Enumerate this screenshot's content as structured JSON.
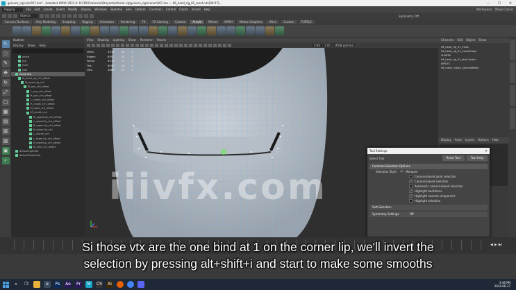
{
  "window": {
    "title": "guiasco_rig(vis)r007.ma* - Autodesk MAYA 2022.4: D:\\3D\\Comercial\\Proyectos\\facial rig\\guiasco_rig\\scenes\\007.ma --- 06_head_rig_01_mesh.vtx[99:07]...",
    "minimize": "—",
    "maximize": "☐",
    "close": "✕"
  },
  "menubar": {
    "mode": "Rigging",
    "items": [
      "File",
      "Edit",
      "Create",
      "Select",
      "Modify",
      "Display",
      "Windows",
      "Skeleton",
      "Skin",
      "Deform",
      "Constrain",
      "Control",
      "Cache",
      "Arnold",
      "Help"
    ],
    "workspace_label": "Workspace:",
    "workspace_value": "Maya Classic"
  },
  "statusline": {
    "field1": "Objects",
    "symmetry": "Symmetry: Off"
  },
  "shelf_tabs": [
    "Curves / Surfaces",
    "Poly Modeling",
    "Sculpting",
    "Rigging",
    "Animation",
    "Rendering",
    "FX",
    "FX Caching",
    "Custom",
    "Arnold",
    "Bifrost",
    "MASH",
    "Motion Graphics",
    "XGen",
    "Custom",
    "TURTLE"
  ],
  "shelf_active_index": 9,
  "outliner": {
    "title": "Outliner",
    "menu": [
      "Display",
      "Show",
      "Help"
    ],
    "rows": [
      {
        "label": "persp",
        "indent": 2
      },
      {
        "label": "top",
        "indent": 2
      },
      {
        "label": "front",
        "indent": 2
      },
      {
        "label": "side",
        "indent": 2
      },
      {
        "label": "head_Grp",
        "indent": 1
      },
      {
        "label": "M_head_rig_ctrl_offset",
        "indent": 2
      },
      {
        "label": "M_head_rig_ctrl",
        "indent": 3
      },
      {
        "label": "M_jaw_ctrl_offset",
        "indent": 4
      },
      {
        "label": "L_eye_ctrl_offset",
        "indent": 5
      },
      {
        "label": "R_eye_ctrl_offset",
        "indent": 5
      },
      {
        "label": "L_cheek_ctrl_offset",
        "indent": 5
      },
      {
        "label": "R_cheek_ctrl_offset",
        "indent": 5
      },
      {
        "label": "M_nose_ctrl_offset",
        "indent": 5
      },
      {
        "label": "M_mouth_ctrl",
        "indent": 5
      },
      {
        "label": "M_upperLip_ctrl_offset",
        "indent": 6
      },
      {
        "label": "L_upperLip_ctrl_offset",
        "indent": 6
      },
      {
        "label": "R_upperLip_ctrl_offset",
        "indent": 6
      },
      {
        "label": "M_lowerLip_ctrl",
        "indent": 6
      },
      {
        "label": "L_corner_ctrl",
        "indent": 6
      },
      {
        "label": "L_lowerLip_ctrl_offset",
        "indent": 6
      },
      {
        "label": "R_lowerLip_ctrl_offset",
        "indent": 6
      },
      {
        "label": "M_chin_ctrl_offset",
        "indent": 6
      },
      {
        "label": "defaultLightSet",
        "indent": 1
      },
      {
        "label": "defaultObjectSet",
        "indent": 1
      }
    ],
    "highlighted_index": 4
  },
  "viewport": {
    "menu": [
      "View",
      "Shading",
      "Lighting",
      "Show",
      "Renderer",
      "Panels"
    ],
    "hud": [
      {
        "label": "Verts:",
        "a": "4316",
        "b": "40",
        "c": "0"
      },
      {
        "label": "Edges:",
        "a": "8592",
        "b": "52",
        "c": "0"
      },
      {
        "label": "Faces:",
        "a": "4278",
        "b": "13",
        "c": "0"
      },
      {
        "label": "Tris:",
        "a": "8496",
        "b": "26",
        "c": "0"
      },
      {
        "label": "UVs:",
        "a": "4686",
        "b": "47",
        "c": "0"
      }
    ],
    "camera_fields": [
      "0.00",
      "1.00",
      "sRGB gamma"
    ],
    "watermark": "iiivfx.com"
  },
  "channelbox": {
    "menu": [
      "Channels",
      "Edit",
      "Object",
      "Show"
    ],
    "nodes": [
      "06_head_rig_01_mesh",
      "06_head_rig_01_meshShape",
      "SHAPES",
      "06_head_rig_01_skinCluster",
      "INPUTS",
      "06_mesh_rotate_SkinnedMesh"
    ],
    "layer_tabs": [
      "Display",
      "Anim"
    ],
    "layer_menu": [
      "Layers",
      "Options",
      "Help"
    ]
  },
  "tool_settings": {
    "title": "Tool Settings",
    "tool_label": "Select Tool",
    "reset_button": "Reset Tool",
    "help_button": "Tool Help",
    "section_common": "Common Selection Options",
    "selection_style_label": "Selection Style:",
    "selection_style_value": "Marquee",
    "drag_label": "Camera-based paint selection",
    "options": [
      {
        "label": "Camera-based selection",
        "checked": true
      },
      {
        "label": "Automatic camera-based selection",
        "checked": false
      },
      {
        "label": "Highlight backfaces",
        "checked": true
      },
      {
        "label": "Highlight nearest component",
        "checked": true
      },
      {
        "label": "Highlight selection",
        "checked": false
      }
    ],
    "soft_section": "Soft Selection",
    "symmetry_label": "Symmetry Settings",
    "symmetry_value": "Off"
  },
  "subtitle": {
    "line1": "Si those vtx are the one bind at 1 on the corner lip, we'll invert the",
    "line2": "selection by pressing alt+shift+i and start to make some smooths"
  },
  "taskbar": {
    "apps": [
      "e",
      "Ps",
      "Ae",
      "Pr",
      "M",
      "Ch",
      "Ai"
    ],
    "time": "3:46 PM",
    "date": "2024-06-27"
  },
  "colors": {
    "maya_bg": "#444444",
    "selection_blue": "#5a85a8",
    "mesh_wire": "#7fb4e0",
    "titlebar": "#f0f0f0"
  }
}
